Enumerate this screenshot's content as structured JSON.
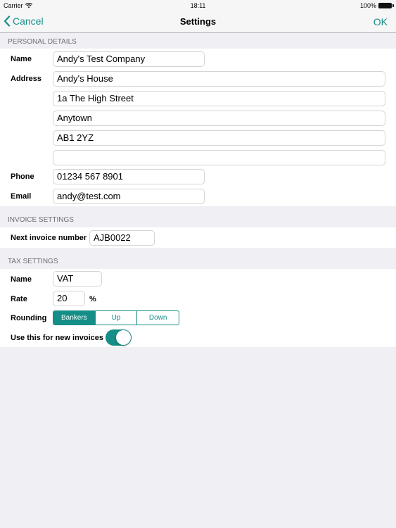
{
  "status_bar": {
    "carrier": "Carrier",
    "time": "18:11",
    "battery": "100%"
  },
  "nav": {
    "cancel_label": "Cancel",
    "title": "Settings",
    "ok_label": "OK"
  },
  "personal": {
    "header": "PERSONAL DETAILS",
    "name_label": "Name",
    "name_value": "Andy's Test Company",
    "address_label": "Address",
    "address_lines": [
      "Andy's House",
      "1a The High Street",
      "Anytown",
      "AB1 2YZ",
      ""
    ],
    "phone_label": "Phone",
    "phone_value": "01234 567 8901",
    "email_label": "Email",
    "email_value": "andy@test.com"
  },
  "invoice": {
    "header": "INVOICE SETTINGS",
    "next_label": "Next invoice number",
    "next_value": "AJB0022"
  },
  "tax": {
    "header": "TAX SETTINGS",
    "name_label": "Name",
    "name_value": "VAT",
    "rate_label": "Rate",
    "rate_value": "20",
    "rate_unit": "%",
    "rounding_label": "Rounding",
    "rounding_options": [
      "Bankers",
      "Up",
      "Down"
    ],
    "rounding_selected": "Bankers",
    "use_label": "Use this for new invoices",
    "use_enabled": true
  },
  "colors": {
    "accent": "#148e86",
    "background": "#efeff4"
  }
}
